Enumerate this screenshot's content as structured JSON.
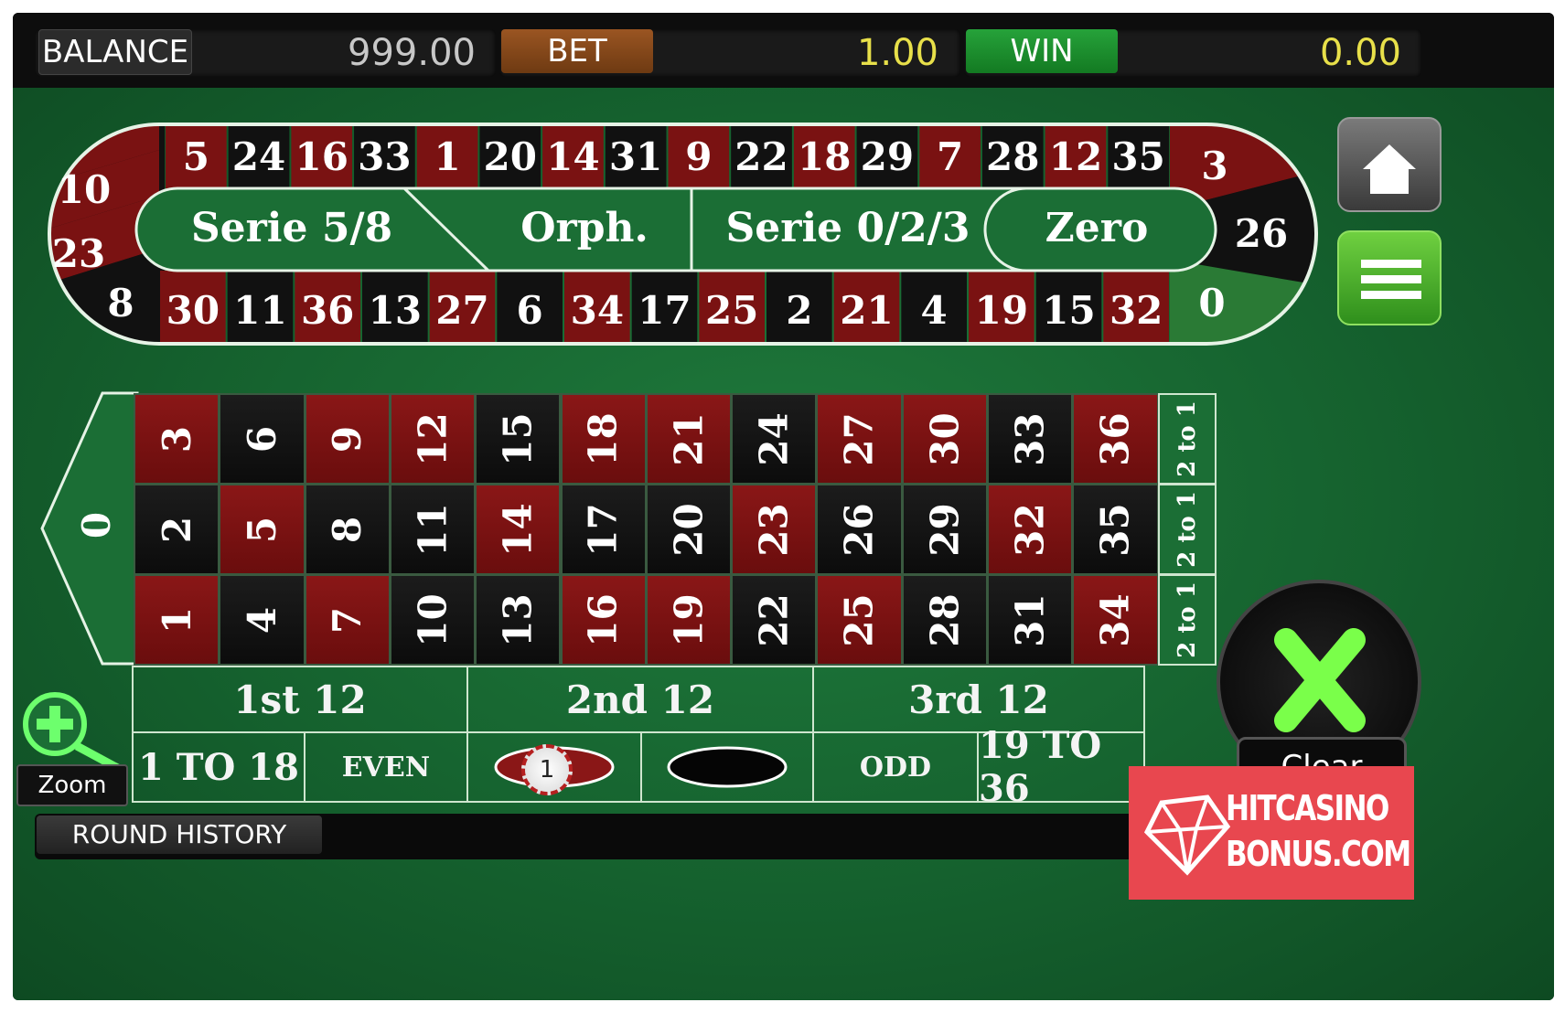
{
  "topbar": {
    "balance_label": "BALANCE",
    "balance_value": "999.00",
    "bet_label": "BET",
    "bet_value": "1.00",
    "win_label": "WIN",
    "win_value": "0.00"
  },
  "colors": {
    "red": "#7a1212",
    "black": "#111111",
    "green": "#1b6e35",
    "gold": "#e8e04a",
    "bet_tab": "#8a4b1c",
    "win_tab": "#1b8a2a"
  },
  "racetrack": {
    "top_numbers": [
      "5",
      "24",
      "16",
      "33",
      "1",
      "20",
      "14",
      "31",
      "9",
      "22",
      "18",
      "29",
      "7",
      "28",
      "12",
      "35"
    ],
    "bottom_numbers": [
      "30",
      "11",
      "36",
      "13",
      "27",
      "6",
      "34",
      "17",
      "25",
      "2",
      "21",
      "4",
      "19",
      "15",
      "32"
    ],
    "left_numbers": [
      "10",
      "23",
      "8"
    ],
    "right_numbers": [
      "3",
      "26",
      "0"
    ],
    "sectors": [
      "Serie 5/8",
      "Orph.",
      "Serie 0/2/3",
      "Zero"
    ]
  },
  "table": {
    "zero": "0",
    "rows": [
      [
        "3",
        "6",
        "9",
        "12",
        "15",
        "18",
        "21",
        "24",
        "27",
        "30",
        "33",
        "36"
      ],
      [
        "2",
        "5",
        "8",
        "11",
        "14",
        "17",
        "20",
        "23",
        "26",
        "29",
        "32",
        "35"
      ],
      [
        "1",
        "4",
        "7",
        "10",
        "13",
        "16",
        "19",
        "22",
        "25",
        "28",
        "31",
        "34"
      ]
    ],
    "column_bet": "2 to 1",
    "dozens": [
      "1st 12",
      "2nd 12",
      "3rd 12"
    ],
    "outside": [
      "1 TO 18",
      "EVEN",
      "",
      "",
      "ODD",
      "19 TO 36"
    ],
    "chip_value": "1"
  },
  "controls": {
    "zoom_label": "Zoom",
    "round_history_label": "ROUND HISTORY",
    "clear_label": "Clear"
  },
  "watermark": {
    "line1": "HITCASINO",
    "line2": "BONUS.COM"
  }
}
